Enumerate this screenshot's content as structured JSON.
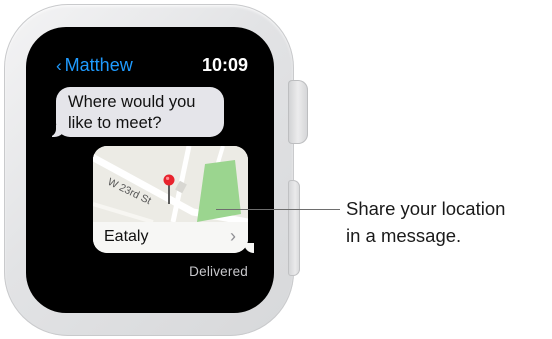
{
  "watch": {
    "header": {
      "back_chevron": "‹",
      "back_label": "Matthew",
      "time": "10:09"
    },
    "incoming_message": {
      "line1": "Where would you",
      "line2": "like to meet?"
    },
    "location_card": {
      "street_label": "W 23rd St",
      "place_name": "Eataly",
      "chevron": "›"
    },
    "delivery_status": "Delivered"
  },
  "callout": {
    "line1": "Share your location",
    "line2": "in a message."
  },
  "colors": {
    "accent": "#1f9bff",
    "bubble": "#e5e5ea",
    "park": "#9bd58f",
    "pin": "#e8232d"
  },
  "icons": {
    "pin": "map-pin-icon",
    "chevron": "chevron-right-icon",
    "back": "chevron-left-icon"
  }
}
